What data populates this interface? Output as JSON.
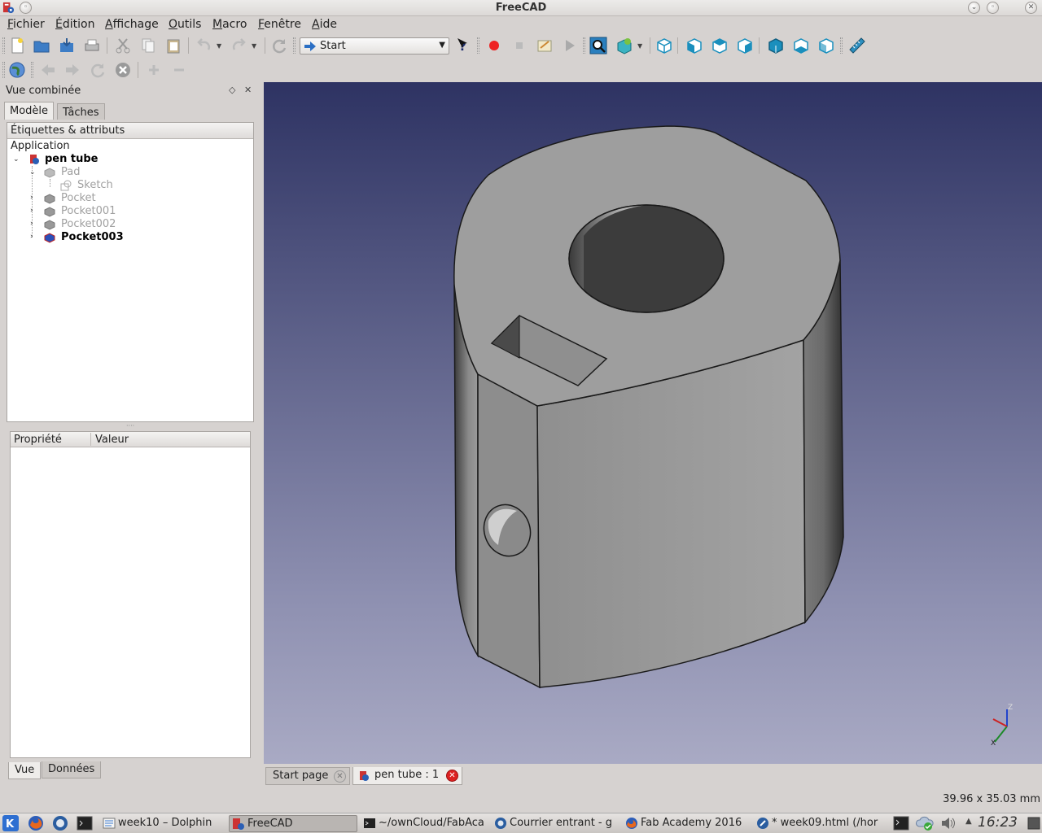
{
  "window": {
    "title": "FreeCAD"
  },
  "menu": [
    "Fichier",
    "Édition",
    "Affichage",
    "Outils",
    "Macro",
    "Fenêtre",
    "Aide"
  ],
  "toolbar": {
    "workbench": "Start"
  },
  "combo": {
    "title": "Vue combinée",
    "tabs": [
      "Modèle",
      "Tâches"
    ],
    "tree_header": "Étiquettes & attributs",
    "tree": [
      {
        "label": "Application",
        "style": "normal"
      },
      {
        "label": "pen tube",
        "style": "bold"
      },
      {
        "label": "Pad",
        "style": "dim"
      },
      {
        "label": "Sketch",
        "style": "dim"
      },
      {
        "label": "Pocket",
        "style": "dim"
      },
      {
        "label": "Pocket001",
        "style": "dim"
      },
      {
        "label": "Pocket002",
        "style": "dim"
      },
      {
        "label": "Pocket003",
        "style": "bold"
      }
    ],
    "prop_headers": {
      "property": "Propriété",
      "value": "Valeur"
    },
    "bottom_tabs": [
      "Vue",
      "Données"
    ]
  },
  "doc_tabs": [
    "Start page",
    "pen tube : 1"
  ],
  "status": {
    "dimensions": "39.96 x 35.03 mm"
  },
  "axis": {
    "z": "Z",
    "x": "X"
  },
  "taskbar": {
    "items": [
      "week10 – Dolphin",
      "FreeCAD",
      "~/ownCloud/FabAca",
      "Courrier entrant - g",
      "Fab Academy 2016",
      "* week09.html (/hor"
    ],
    "clock": "16:23"
  },
  "colors": {
    "viewport_top": "#2e3363",
    "viewport_bottom": "#a9aac4",
    "accent_blue": "#1a8fbd"
  }
}
